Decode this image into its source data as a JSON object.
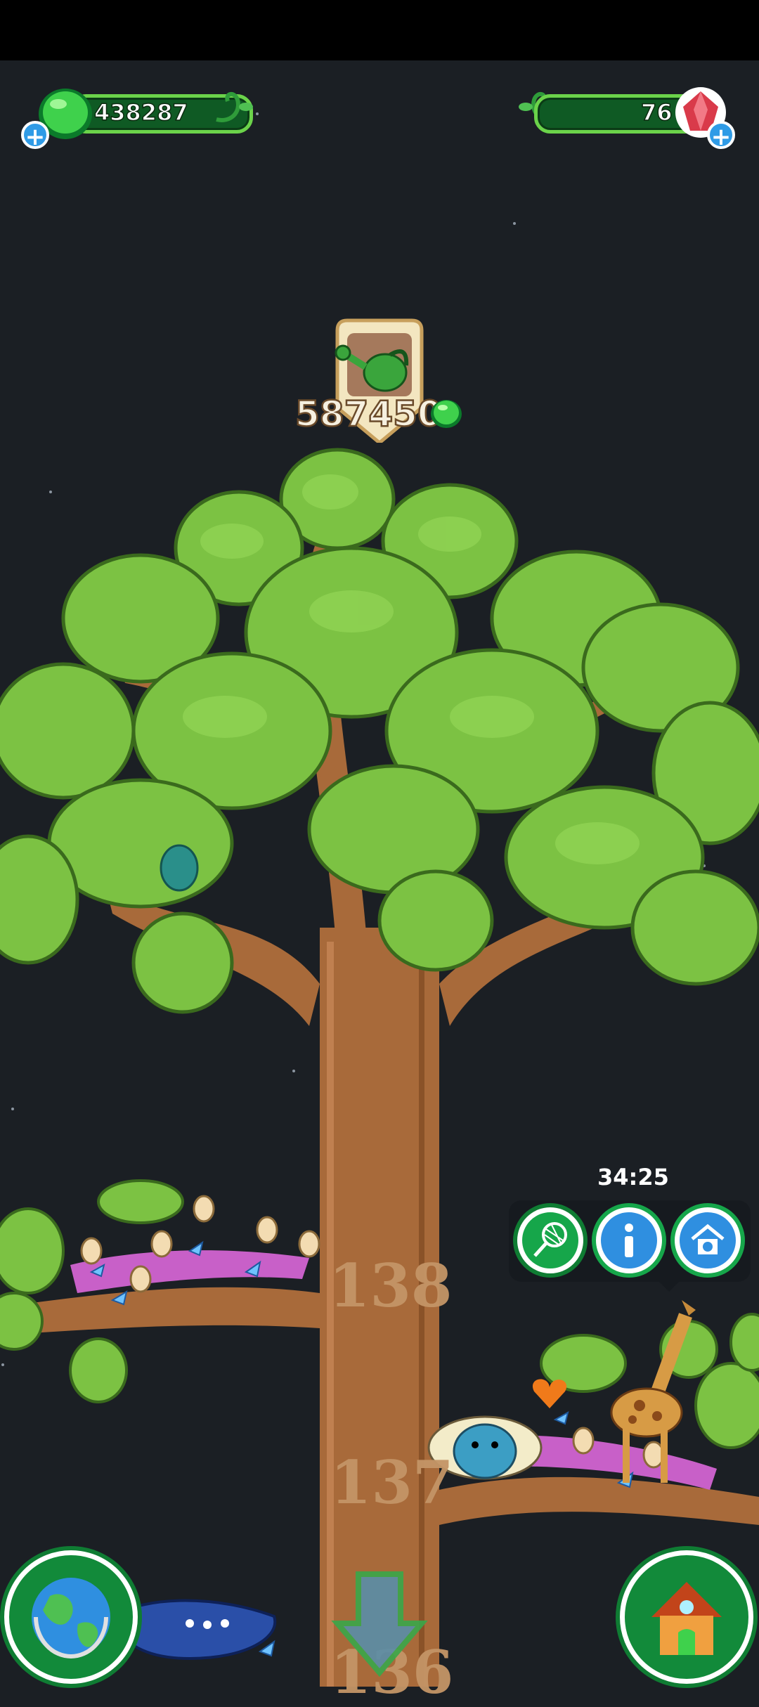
{
  "status_bar": {},
  "currencies": {
    "greenies": "438287",
    "gems": "76"
  },
  "watering": {
    "cost": "587450"
  },
  "branches": {
    "level_top": "138",
    "level_mid": "137",
    "level_bottom": "136"
  },
  "popup": {
    "timer": "34:25",
    "buttons": [
      "net-icon",
      "info-icon",
      "habitat-icon"
    ]
  },
  "nav": {
    "left": "globe-icon",
    "center": "scroll-down-arrow-icon",
    "right": "house-icon"
  },
  "colors": {
    "accent_green": "#16a64a",
    "gem_red": "#d93a4a",
    "bark": "#a86a3a"
  }
}
